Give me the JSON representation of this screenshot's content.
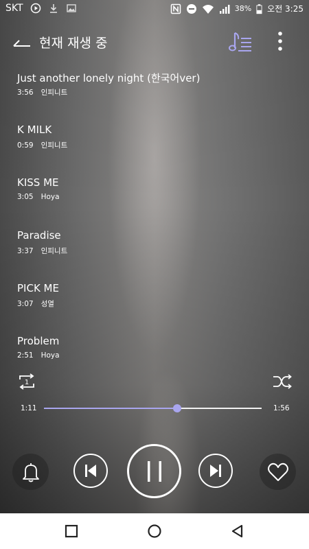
{
  "status_bar": {
    "carrier": "SKT",
    "battery_percent": "38%",
    "time": "오전 3:25",
    "icons": [
      "play-circle-icon",
      "download-icon",
      "image-icon",
      "nfc-icon",
      "do-not-disturb-icon",
      "wifi-icon",
      "signal-icon",
      "battery-icon"
    ]
  },
  "header": {
    "title": "현재 재생 중",
    "queue_icon_color": "#a9a6ef"
  },
  "songs": [
    {
      "title": "Just another lonely night (한국어ver)",
      "duration": "3:56",
      "artist": "인피니트"
    },
    {
      "title": "K MILK",
      "duration": "0:59",
      "artist": "인피니트"
    },
    {
      "title": "KISS ME",
      "duration": "3:05",
      "artist": "Hoya"
    },
    {
      "title": "Paradise",
      "duration": "3:37",
      "artist": "인피니트"
    },
    {
      "title": "PICK ME",
      "duration": "3:07",
      "artist": "성열"
    },
    {
      "title": "Problem",
      "duration": "2:51",
      "artist": "Hoya"
    }
  ],
  "player": {
    "repeat_badge": "1",
    "elapsed": "1:11",
    "total": "1:56",
    "progress": 0.612,
    "accent": "#a9a6ef",
    "state": "playing"
  },
  "nav_bar": {
    "icons": [
      "recent-apps-icon",
      "home-icon",
      "back-icon"
    ]
  }
}
